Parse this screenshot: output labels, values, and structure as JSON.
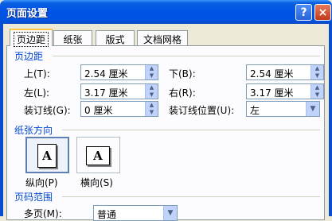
{
  "window": {
    "title": "页面设置",
    "help_glyph": "?",
    "close_glyph": "×"
  },
  "tabs": [
    {
      "label": "页边距"
    },
    {
      "label": "纸张"
    },
    {
      "label": "版式"
    },
    {
      "label": "文档网格"
    }
  ],
  "margins": {
    "section_title": "页边距",
    "top_label": "上(T):",
    "top_value": "2.54 厘米",
    "bottom_label": "下(B):",
    "bottom_value": "2.54 厘米",
    "left_label": "左(L):",
    "left_value": "3.17 厘米",
    "right_label": "右(R):",
    "right_value": "3.17 厘米",
    "gutter_label": "装订线(G):",
    "gutter_value": "0 厘米",
    "gutter_pos_label": "装订线位置(U):",
    "gutter_pos_value": "左"
  },
  "orientation": {
    "section_title": "纸张方向",
    "portrait_label": "纵向(P)",
    "landscape_label": "横向(S)",
    "icon_letter": "A",
    "selected": "portrait"
  },
  "pages": {
    "section_title": "页码范围",
    "multiple_label": "多页(M):",
    "multiple_value": "普通"
  },
  "glyphs": {
    "up": "▲",
    "down": "▼",
    "dropdown": "▼"
  }
}
